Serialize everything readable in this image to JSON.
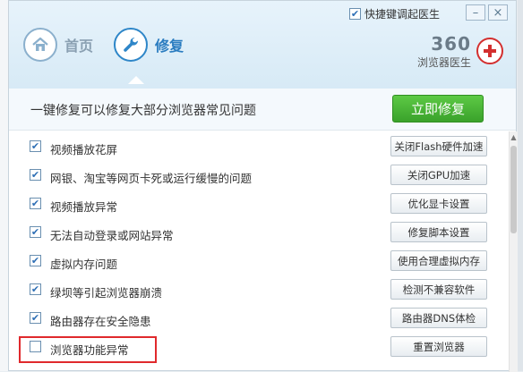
{
  "header": {
    "hotkey_label": "快捷键调起医生",
    "hotkey_checked": true,
    "tabs": [
      {
        "label": "首页",
        "icon": "home-icon",
        "active": false
      },
      {
        "label": "修复",
        "icon": "wrench-icon",
        "active": true
      }
    ],
    "brand_number": "360",
    "brand_sub": "浏览器医生",
    "window_buttons": {
      "minimize": "–",
      "close": "×"
    }
  },
  "banner": {
    "text": "一键修复可以修复大部分浏览器常见问题",
    "fix_button": "立即修复"
  },
  "items": [
    {
      "label": "视频播放花屏",
      "button": "关闭Flash硬件加速",
      "checked": true
    },
    {
      "label": "网银、淘宝等网页卡死或运行缓慢的问题",
      "button": "关闭GPU加速",
      "checked": true
    },
    {
      "label": "视频播放异常",
      "button": "优化显卡设置",
      "checked": true
    },
    {
      "label": "无法自动登录或网站异常",
      "button": "修复脚本设置",
      "checked": true
    },
    {
      "label": "虚拟内存问题",
      "button": "使用合理虚拟内存",
      "checked": true
    },
    {
      "label": "绿坝等引起浏览器崩溃",
      "button": "检测不兼容软件",
      "checked": true
    },
    {
      "label": "路由器存在安全隐患",
      "button": "路由器DNS体检",
      "checked": true
    },
    {
      "label": "浏览器功能异常",
      "button": "重置浏览器",
      "checked": false
    }
  ],
  "colors": {
    "accent_blue": "#2a7cc0",
    "primary_green": "#3aa22b",
    "highlight_red": "#e0292c"
  }
}
